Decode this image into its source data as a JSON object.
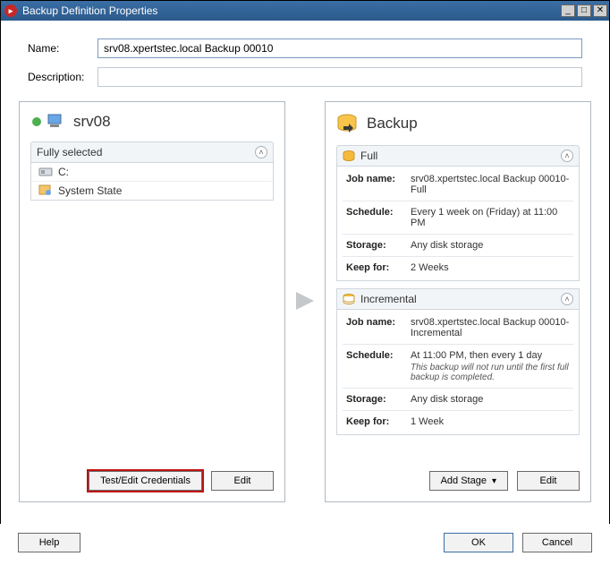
{
  "window": {
    "title": "Backup Definition Properties",
    "name_label": "Name:",
    "name_value": "srv08.xpertstec.local Backup 00010",
    "desc_label": "Description:",
    "desc_value": ""
  },
  "left": {
    "server": "srv08",
    "fully_selected": "Fully selected",
    "drive": "C:",
    "system_state": "System State",
    "test_edit": "Test/Edit Credentials",
    "edit": "Edit"
  },
  "right": {
    "title": "Backup",
    "full": {
      "heading": "Full",
      "job_k": "Job name:",
      "job_v": "srv08.xpertstec.local Backup 00010-Full",
      "sch_k": "Schedule:",
      "sch_v": "Every 1 week on (Friday) at 11:00 PM",
      "sto_k": "Storage:",
      "sto_v": "Any disk storage",
      "keep_k": "Keep for:",
      "keep_v": "2 Weeks"
    },
    "inc": {
      "heading": "Incremental",
      "job_k": "Job name:",
      "job_v": "srv08.xpertstec.local Backup 00010-Incremental",
      "sch_k": "Schedule:",
      "sch_v": "At 11:00 PM, then every 1 day",
      "sch_sub": "This backup will not run until the first full backup is completed.",
      "sto_k": "Storage:",
      "sto_v": "Any disk storage",
      "keep_k": "Keep for:",
      "keep_v": "1 Week"
    },
    "add_stage": "Add Stage",
    "edit": "Edit"
  },
  "footer": {
    "help": "Help",
    "ok": "OK",
    "cancel": "Cancel"
  }
}
